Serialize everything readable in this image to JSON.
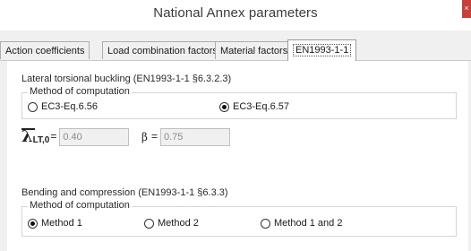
{
  "window": {
    "title": "National Annex parameters",
    "close_glyph": "×"
  },
  "tabs": [
    {
      "label": "Action coefficients"
    },
    {
      "label": "Load combination factors"
    },
    {
      "label": "Material factors"
    },
    {
      "label": "EN1993-1-1"
    }
  ],
  "active_tab": "EN1993-1-1",
  "ltb": {
    "title": "Lateral torsional buckling (EN1993-1-1 §6.3.2.3)",
    "group_label": "Method of computation",
    "options": [
      {
        "label": "EC3-Eq.6.56",
        "checked": false
      },
      {
        "label": "EC3-Eq.6.57",
        "checked": true
      }
    ],
    "lambda_symbol": "λ",
    "lambda_subscript": "LT,0",
    "lambda_eq": "=",
    "lambda_value": "0.40",
    "beta_symbol": "β",
    "beta_eq": "=",
    "beta_value": "0.75"
  },
  "bc": {
    "title": "Bending and compression (EN1993-1-1 §6.3.3)",
    "group_label": "Method of computation",
    "options": [
      {
        "label": "Method 1",
        "checked": true
      },
      {
        "label": "Method 2",
        "checked": false
      },
      {
        "label": "Method 1 and 2",
        "checked": false
      }
    ]
  }
}
